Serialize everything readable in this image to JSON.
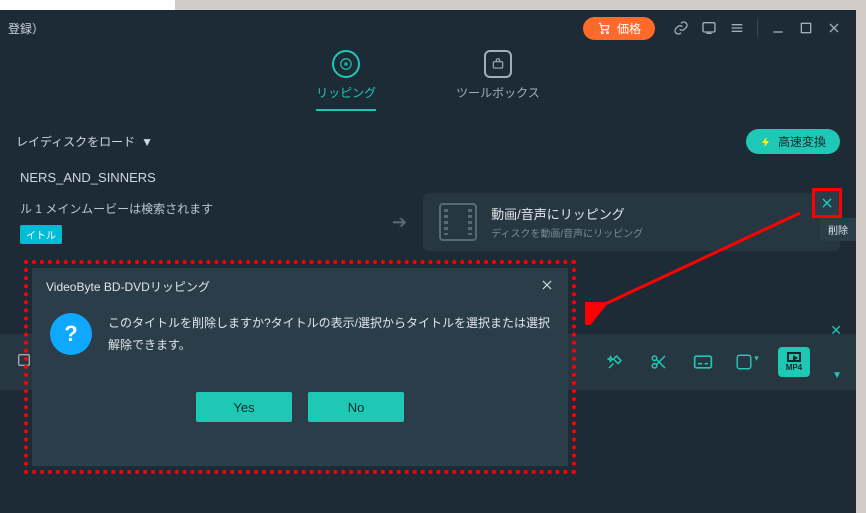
{
  "titlebar": {
    "registration": "登録）",
    "price_label": "価格"
  },
  "tabs": {
    "ripping": "リッピング",
    "toolbox": "ツールボックス"
  },
  "secondbar": {
    "load_label": "レイディスクをロード",
    "fast_label": "高速変換"
  },
  "content": {
    "title_name": "NERS_AND_SINNERS",
    "movie_status": "ル 1 メインムービーは検索されます",
    "title_tag": "イトル",
    "ripcard_title": "動画/音声にリッピング",
    "ripcard_sub": "ディスクを動画/音声にリッピング"
  },
  "toolbar": {
    "mp4": "MP4"
  },
  "closebox": {
    "delete_label": "削除"
  },
  "dialog": {
    "title": "VideoByte BD-DVDリッピング",
    "message": "このタイトルを削除しますか?タイトルの表示/選択からタイトルを選択または選択解除できます。",
    "yes": "Yes",
    "no": "No"
  }
}
